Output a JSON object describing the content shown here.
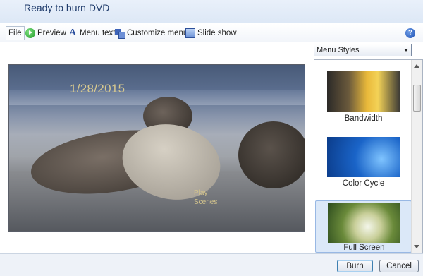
{
  "window": {
    "title": "Ready to burn DVD"
  },
  "toolbar": {
    "file_label": "File",
    "preview_label": "Preview",
    "menu_text_label": "Menu text",
    "customize_menu_label": "Customize menu",
    "slide_show_label": "Slide show",
    "help_symbol": "?"
  },
  "preview": {
    "date_text": "1/28/2015",
    "menu_items": [
      "Play",
      "Scenes"
    ]
  },
  "menu_styles": {
    "select_value": "Menu Styles",
    "items": [
      {
        "label": "Bandwidth",
        "selected": false
      },
      {
        "label": "Color Cycle",
        "selected": false
      },
      {
        "label": "Full Screen",
        "selected": true
      }
    ]
  },
  "footer": {
    "burn_label": "Burn",
    "cancel_label": "Cancel"
  },
  "icons": {
    "preview": "play-icon",
    "menu_text": "text-a-icon",
    "customize_menu": "customize-icon",
    "slide_show": "slideshow-icon",
    "help": "help-icon"
  },
  "colors": {
    "accent": "#1b4fb3",
    "selection": "#dbe8f8",
    "title_text": "#1e3a6a"
  }
}
